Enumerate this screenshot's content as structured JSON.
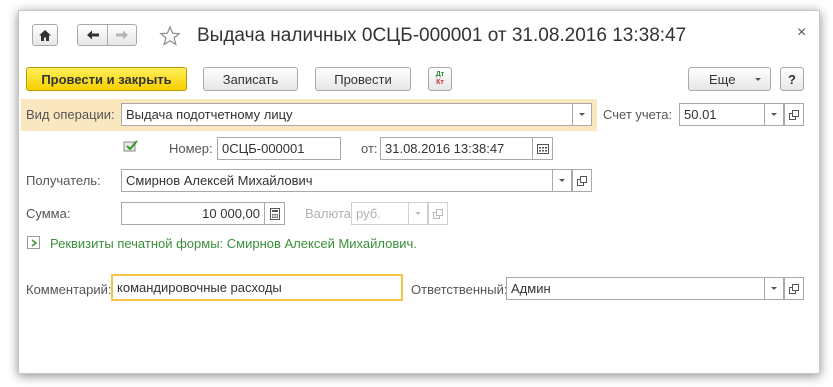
{
  "window": {
    "title": "Выдача наличных 0СЦБ-000001 от 31.08.2016 13:38:47",
    "close_glyph": "×"
  },
  "toolbar": {
    "post_close_label": "Провести и закрыть",
    "save_label": "Записать",
    "post_label": "Провести",
    "dt_kt_top": "Дт",
    "dt_kt_bottom": "Кт",
    "more_label": "Еще",
    "help_label": "?"
  },
  "form": {
    "operation_type": {
      "label": "Вид операции:",
      "value": "Выдача подотчетному лицу"
    },
    "account": {
      "label": "Счет учета:",
      "value": "50.01"
    },
    "number": {
      "label": "Номер:",
      "value": "0СЦБ-000001"
    },
    "date": {
      "label": "от:",
      "value": "31.08.2016 13:38:47"
    },
    "recipient": {
      "label": "Получатель:",
      "value": "Смирнов Алексей Михайлович"
    },
    "amount": {
      "label": "Сумма:",
      "value": "10 000,00"
    },
    "currency": {
      "label": "Валюта:",
      "value": "руб."
    },
    "print_details": {
      "text": "Реквизиты печатной формы: Смирнов Алексей Михайлович."
    },
    "comment": {
      "label": "Комментарий:",
      "value": "командировочные расходы"
    },
    "responsible": {
      "label": "Ответственный:",
      "value": "Админ"
    }
  },
  "colors": {
    "primary_button": "#f6cf00",
    "operation_highlight": "#fbe7bf",
    "link_green": "#3a8f3a"
  }
}
